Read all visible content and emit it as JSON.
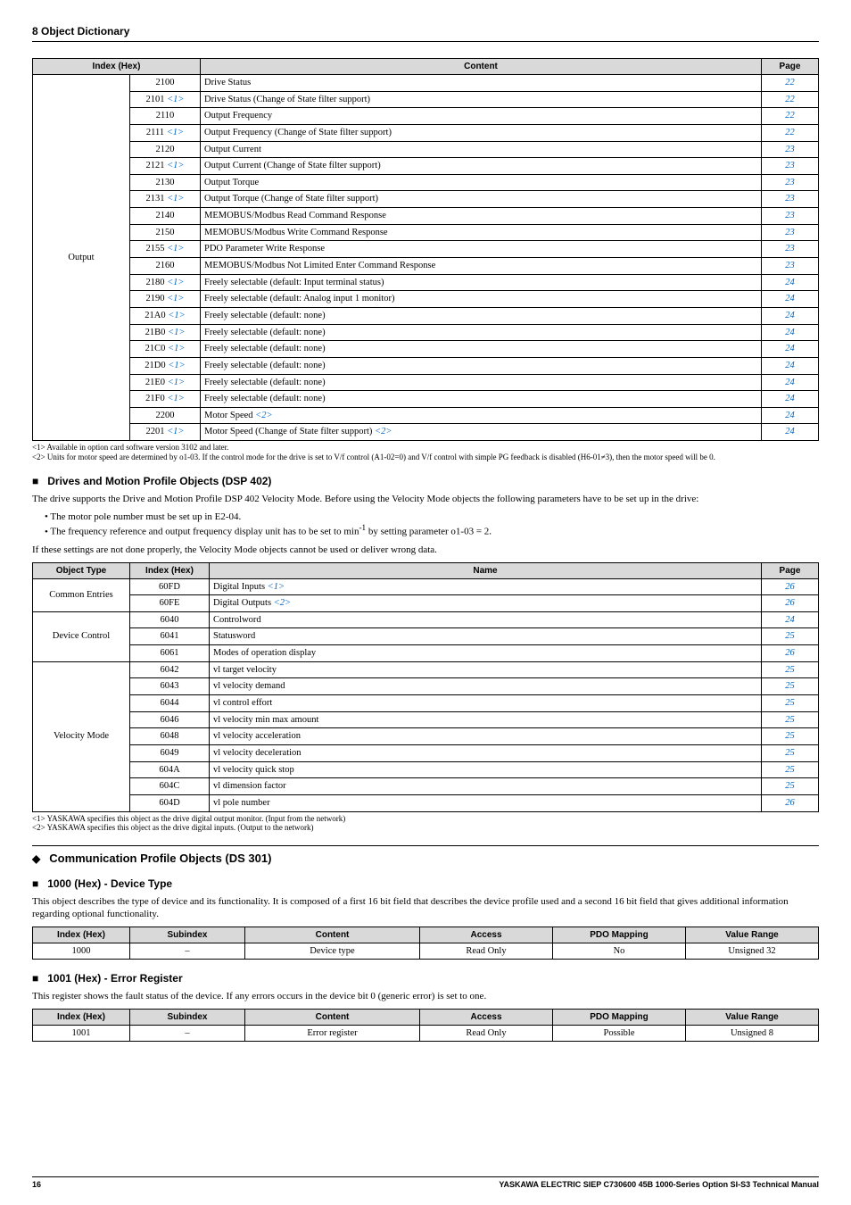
{
  "header": {
    "title": "8  Object Dictionary"
  },
  "table1": {
    "headers": [
      "Index (Hex)",
      "Content",
      "Page"
    ],
    "group_label": "Output",
    "rows": [
      {
        "idx": "2100",
        "sup": "",
        "content": "Drive Status",
        "page": "22"
      },
      {
        "idx": "2101",
        "sup": "<1>",
        "content": "Drive Status (Change of State filter support)",
        "page": "22"
      },
      {
        "idx": "2110",
        "sup": "",
        "content": "Output Frequency",
        "page": "22"
      },
      {
        "idx": "2111",
        "sup": "<1>",
        "content": "Output Frequency (Change of State filter support)",
        "page": "22"
      },
      {
        "idx": "2120",
        "sup": "",
        "content": "Output Current",
        "page": "23"
      },
      {
        "idx": "2121",
        "sup": "<1>",
        "content": "Output Current (Change of State filter support)",
        "page": "23"
      },
      {
        "idx": "2130",
        "sup": "",
        "content": "Output Torque",
        "page": "23"
      },
      {
        "idx": "2131",
        "sup": "<1>",
        "content": "Output Torque (Change of State filter support)",
        "page": "23"
      },
      {
        "idx": "2140",
        "sup": "",
        "content": "MEMOBUS/Modbus Read Command Response",
        "page": "23"
      },
      {
        "idx": "2150",
        "sup": "",
        "content": "MEMOBUS/Modbus Write Command Response",
        "page": "23"
      },
      {
        "idx": "2155",
        "sup": "<1>",
        "content": "PDO Parameter Write Response",
        "page": "23"
      },
      {
        "idx": "2160",
        "sup": "",
        "content": "MEMOBUS/Modbus Not Limited Enter Command Response",
        "page": "23"
      },
      {
        "idx": "2180",
        "sup": "<1>",
        "content": "Freely selectable (default: Input terminal status)",
        "page": "24"
      },
      {
        "idx": "2190",
        "sup": "<1>",
        "content": "Freely selectable (default: Analog input 1 monitor)",
        "page": "24"
      },
      {
        "idx": "21A0",
        "sup": "<1>",
        "content": "Freely selectable (default: none)",
        "page": "24"
      },
      {
        "idx": "21B0",
        "sup": "<1>",
        "content": "Freely selectable (default: none)",
        "page": "24"
      },
      {
        "idx": "21C0",
        "sup": "<1>",
        "content": "Freely selectable (default: none)",
        "page": "24"
      },
      {
        "idx": "21D0",
        "sup": "<1>",
        "content": "Freely selectable (default: none)",
        "page": "24"
      },
      {
        "idx": "21E0",
        "sup": "<1>",
        "content": "Freely selectable (default: none)",
        "page": "24"
      },
      {
        "idx": "21F0",
        "sup": "<1>",
        "content": "Freely selectable (default: none)",
        "page": "24"
      },
      {
        "idx": "2200",
        "sup": "",
        "content": "Motor Speed <2>",
        "content_plain": "Motor Speed ",
        "content_sup": "<2>",
        "page": "24"
      },
      {
        "idx": "2201",
        "sup": "<1>",
        "content_plain": "Motor Speed (Change of State filter support) ",
        "content_sup": "<2>",
        "page": "24"
      }
    ]
  },
  "footnotes1": {
    "n1": "<1> Available in option card software version 3102 and later.",
    "n2": "<2> Units for motor speed are determined by o1-03. If the control mode for the drive is set to V/f control (A1-02=0) and V/f control with simple PG feedback is disabled (H6-01≠3), then the motor speed will be 0."
  },
  "dsp": {
    "heading": "Drives and Motion Profile Objects (DSP 402)",
    "intro": "The drive supports the Drive and Motion Profile DSP 402 Velocity Mode. Before using the Velocity Mode objects the following parameters have to be set up in the drive:",
    "bullet1": "The motor pole number must be set up in E2-04.",
    "bullet2_a": "The frequency reference and output frequency display unit has to be set to min",
    "bullet2_b": " by setting parameter o1-03 = 2.",
    "closing": "If these settings are not done properly, the Velocity Mode objects cannot be used or deliver wrong data."
  },
  "table2": {
    "headers": [
      "Object Type",
      "Index (Hex)",
      "Name",
      "Page"
    ],
    "groups": [
      {
        "label": "Common Entries",
        "rows": [
          {
            "idx": "60FD",
            "name": "Digital Inputs ",
            "sup": "<1>",
            "page": "26"
          },
          {
            "idx": "60FE",
            "name": "Digital Outputs ",
            "sup": "<2>",
            "page": "26"
          }
        ]
      },
      {
        "label": "Device Control",
        "rows": [
          {
            "idx": "6040",
            "name": "Controlword",
            "sup": "",
            "page": "24"
          },
          {
            "idx": "6041",
            "name": "Statusword",
            "sup": "",
            "page": "25"
          },
          {
            "idx": "6061",
            "name": "Modes of operation display",
            "sup": "",
            "page": "26"
          }
        ]
      },
      {
        "label": "Velocity Mode",
        "rows": [
          {
            "idx": "6042",
            "name": "vl target velocity",
            "sup": "",
            "page": "25"
          },
          {
            "idx": "6043",
            "name": "vl velocity demand",
            "sup": "",
            "page": "25"
          },
          {
            "idx": "6044",
            "name": "vl control effort",
            "sup": "",
            "page": "25"
          },
          {
            "idx": "6046",
            "name": "vl velocity min max amount",
            "sup": "",
            "page": "25"
          },
          {
            "idx": "6048",
            "name": "vl velocity acceleration",
            "sup": "",
            "page": "25"
          },
          {
            "idx": "6049",
            "name": "vl velocity deceleration",
            "sup": "",
            "page": "25"
          },
          {
            "idx": "604A",
            "name": "vl velocity quick stop",
            "sup": "",
            "page": "25"
          },
          {
            "idx": "604C",
            "name": "vl dimension factor",
            "sup": "",
            "page": "25"
          },
          {
            "idx": "604D",
            "name": "vl pole number",
            "sup": "",
            "page": "26"
          }
        ]
      }
    ]
  },
  "footnotes2": {
    "n1": "<1> YASKAWA specifies this object as the drive digital output monitor. (Input from the network)",
    "n2": "<2> YASKAWA specifies this object as the drive digital inputs. (Output to the network)"
  },
  "comm": {
    "heading": "Communication Profile Objects (DS 301)"
  },
  "dev_type": {
    "heading": "1000 (Hex) - Device Type",
    "para": "This object describes the type of device and its functionality. It is composed of a first 16 bit field that describes the device profile used and a second 16 bit field that gives additional information regarding optional functionality.",
    "headers": [
      "Index (Hex)",
      "Subindex",
      "Content",
      "Access",
      "PDO Mapping",
      "Value Range"
    ],
    "row": {
      "idx": "1000",
      "sub": "–",
      "content": "Device type",
      "access": "Read Only",
      "pdo": "No",
      "range": "Unsigned 32"
    }
  },
  "err_reg": {
    "heading": "1001 (Hex) - Error Register",
    "para": "This register shows the fault status of the device. If any errors occurs in the device bit 0 (generic error) is set to one.",
    "headers": [
      "Index (Hex)",
      "Subindex",
      "Content",
      "Access",
      "PDO Mapping",
      "Value Range"
    ],
    "row": {
      "idx": "1001",
      "sub": "–",
      "content": "Error register",
      "access": "Read Only",
      "pdo": "Possible",
      "range": "Unsigned 8"
    }
  },
  "footer": {
    "page": "16",
    "manual": "YASKAWA ELECTRIC SIEP C730600 45B 1000-Series Option SI-S3 Technical Manual"
  }
}
